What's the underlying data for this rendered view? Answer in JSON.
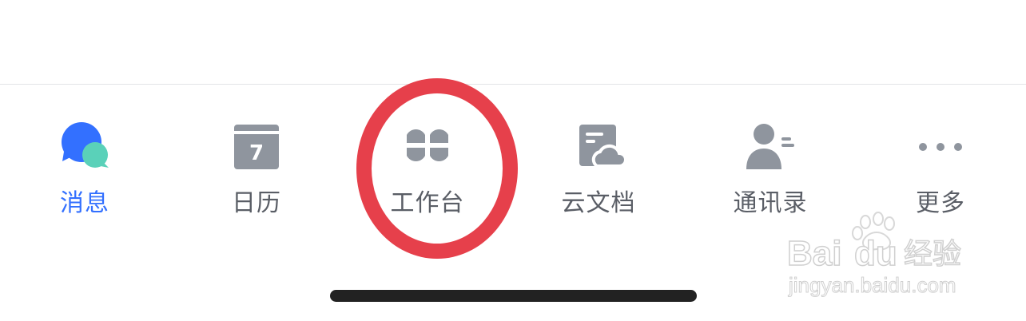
{
  "tabs": [
    {
      "id": "messages",
      "label": "消息",
      "icon": "chat-bubbles-icon",
      "active": true
    },
    {
      "id": "calendar",
      "label": "日历",
      "icon": "calendar-icon",
      "calendar_day": "7",
      "active": false
    },
    {
      "id": "workplace",
      "label": "工作台",
      "icon": "four-petal-grid-icon",
      "active": false
    },
    {
      "id": "docs",
      "label": "云文档",
      "icon": "cloud-document-icon",
      "active": false
    },
    {
      "id": "contacts",
      "label": "通讯录",
      "icon": "contact-person-icon",
      "active": false
    },
    {
      "id": "more",
      "label": "更多",
      "icon": "more-dots-icon",
      "active": false
    }
  ],
  "colors": {
    "active_blue": "#3370ff",
    "active_green": "#5ad1b9",
    "icon_gray": "#8f959e",
    "label_gray": "#5a5e66",
    "highlight_red": "#e6404b"
  },
  "watermark": {
    "brand": "Bai",
    "brand2": "du",
    "suffix": "经验",
    "url": "jingyan.baidu.com"
  }
}
